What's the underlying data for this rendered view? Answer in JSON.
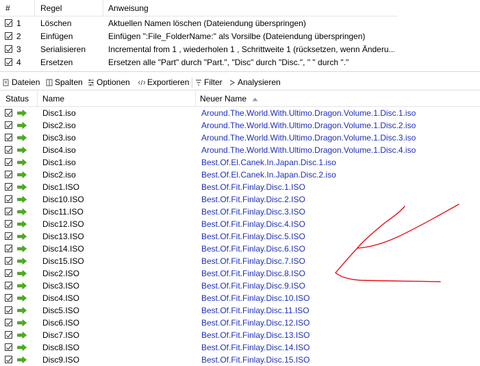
{
  "rules": {
    "headers": {
      "num": "#",
      "rule": "Regel",
      "instruction": "Anweisung"
    },
    "items": [
      {
        "num": "1",
        "name": "Löschen",
        "desc": "Aktuellen Namen löschen (Dateiendung überspringen)"
      },
      {
        "num": "2",
        "name": "Einfügen",
        "desc": "Einfügen \":File_FolderName:\" als Vorsilbe (Dateiendung überspringen)"
      },
      {
        "num": "3",
        "name": "Serialisieren",
        "desc": "Incremental from 1 , wiederholen 1 , Schrittweite 1 (rücksetzen, wenn Änderu..."
      },
      {
        "num": "4",
        "name": "Ersetzen",
        "desc": "Ersetzen alle \"Part\" durch \"Part.\", \"Disc\" durch \"Disc.\", \" \" durch \".\""
      }
    ]
  },
  "toolbar": {
    "files": "Dateien",
    "columns": "Spalten",
    "options": "Optionen",
    "export": "Exportieren",
    "filter": "Filter",
    "analyze": "Analysieren"
  },
  "files": {
    "headers": {
      "status": "Status",
      "name": "Name",
      "new_name": "Neuer Name"
    },
    "rows": [
      {
        "name": "Disc1.iso",
        "new_name": "Around.The.World.With.Ultimo.Dragon.Volume.1.Disc.1.iso"
      },
      {
        "name": "Disc2.iso",
        "new_name": "Around.The.World.With.Ultimo.Dragon.Volume.1.Disc.2.iso"
      },
      {
        "name": "Disc3.iso",
        "new_name": "Around.The.World.With.Ultimo.Dragon.Volume.1.Disc.3.iso"
      },
      {
        "name": "Disc4.iso",
        "new_name": "Around.The.World.With.Ultimo.Dragon.Volume.1.Disc.4.iso"
      },
      {
        "name": "Disc1.iso",
        "new_name": "Best.Of.El.Canek.In.Japan.Disc.1.iso"
      },
      {
        "name": "Disc2.iso",
        "new_name": "Best.Of.El.Canek.In.Japan.Disc.2.iso"
      },
      {
        "name": "Disc1.ISO",
        "new_name": "Best.Of.Fit.Finlay.Disc.1.ISO"
      },
      {
        "name": "Disc10.ISO",
        "new_name": "Best.Of.Fit.Finlay.Disc.2.ISO"
      },
      {
        "name": "Disc11.ISO",
        "new_name": "Best.Of.Fit.Finlay.Disc.3.ISO"
      },
      {
        "name": "Disc12.ISO",
        "new_name": "Best.Of.Fit.Finlay.Disc.4.ISO"
      },
      {
        "name": "Disc13.ISO",
        "new_name": "Best.Of.Fit.Finlay.Disc.5.ISO"
      },
      {
        "name": "Disc14.ISO",
        "new_name": "Best.Of.Fit.Finlay.Disc.6.ISO"
      },
      {
        "name": "Disc15.ISO",
        "new_name": "Best.Of.Fit.Finlay.Disc.7.ISO"
      },
      {
        "name": "Disc2.ISO",
        "new_name": "Best.Of.Fit.Finlay.Disc.8.ISO"
      },
      {
        "name": "Disc3.ISO",
        "new_name": "Best.Of.Fit.Finlay.Disc.9.ISO"
      },
      {
        "name": "Disc4.ISO",
        "new_name": "Best.Of.Fit.Finlay.Disc.10.ISO"
      },
      {
        "name": "Disc5.ISO",
        "new_name": "Best.Of.Fit.Finlay.Disc.11.ISO"
      },
      {
        "name": "Disc6.ISO",
        "new_name": "Best.Of.Fit.Finlay.Disc.12.ISO"
      },
      {
        "name": "Disc7.ISO",
        "new_name": "Best.Of.Fit.Finlay.Disc.13.ISO"
      },
      {
        "name": "Disc8.ISO",
        "new_name": "Best.Of.Fit.Finlay.Disc.14.ISO"
      },
      {
        "name": "Disc9.ISO",
        "new_name": "Best.Of.Fit.Finlay.Disc.15.ISO"
      }
    ]
  },
  "colors": {
    "new_name_text": "#1f2fb8",
    "status_arrow": "#4caf1e",
    "annotation": "#e8101a"
  },
  "icons": {
    "status_arrow": "green-arrow-icon",
    "sort": "sort-ascending-icon"
  }
}
